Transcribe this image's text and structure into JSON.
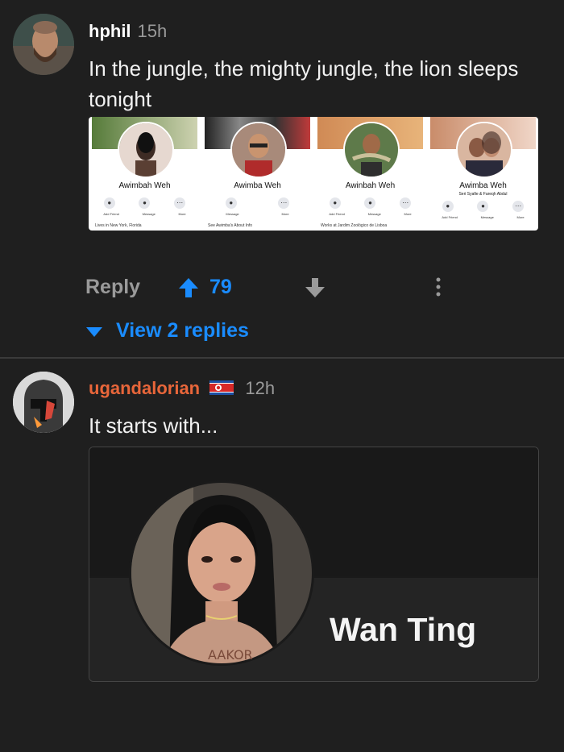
{
  "comments": [
    {
      "username": "hphil",
      "time": "15h",
      "text": "In the jungle, the mighty jungle, the lion sleeps tonight",
      "embedded_image": {
        "profiles": [
          {
            "name": "Awimbah Weh",
            "sub": "",
            "buttons": [
              "Add Friend",
              "Message",
              "More"
            ],
            "info": "Lives in New York, Florida"
          },
          {
            "name": "Awimba Weh",
            "sub": "",
            "buttons": [
              "Message",
              "More"
            ],
            "info": "See Awimba's About Info"
          },
          {
            "name": "Awinbah Weh",
            "sub": "",
            "buttons": [
              "Add Friend",
              "Message",
              "More"
            ],
            "info": "Works at Jardim Zoológico de Lisboa"
          },
          {
            "name": "Awimba Weh",
            "sub": "Seri Syafie & Fareqh Abdul",
            "buttons": [
              "Add Friend",
              "Message",
              "More"
            ],
            "info": ""
          }
        ]
      },
      "actions": {
        "reply": "Reply",
        "votes": "79",
        "view_replies": "View 2 replies"
      }
    },
    {
      "username": "ugandalorian",
      "time": "12h",
      "text": "It starts with...",
      "embedded_image": {
        "name": "Wan Ting",
        "shirt_text": "AAKOR"
      }
    }
  ],
  "colors": {
    "background": "#1f1f1f",
    "accent": "#1a8cff",
    "username2": "#e8663a"
  },
  "icons": [
    "upvote-arrow-icon",
    "downvote-arrow-icon",
    "more-vertical-icon",
    "caret-down-icon",
    "flag-icon"
  ]
}
